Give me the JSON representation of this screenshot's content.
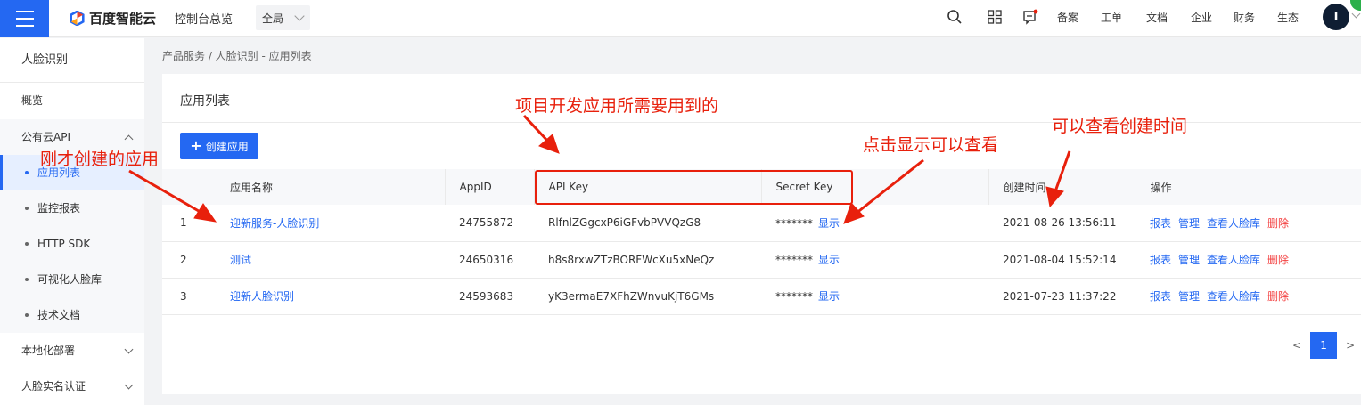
{
  "header": {
    "brand": "百度智能云",
    "console_label": "控制台总览",
    "region": "全局",
    "nav": [
      "备案",
      "工单",
      "文档",
      "企业",
      "财务",
      "生态"
    ],
    "avatar_initial": "I"
  },
  "breadcrumb": "产品服务 / 人脸识别 - 应用列表",
  "sidebar": {
    "title": "人脸识别",
    "items": [
      {
        "label": "概览"
      },
      {
        "label": "公有云API"
      },
      {
        "label": "应用列表"
      },
      {
        "label": "监控报表"
      },
      {
        "label": "HTTP SDK"
      },
      {
        "label": "可视化人脸库"
      },
      {
        "label": "技术文档"
      },
      {
        "label": "本地化部署"
      },
      {
        "label": "人脸实名认证"
      }
    ]
  },
  "panel": {
    "title": "应用列表",
    "create_button": "创建应用",
    "columns": [
      "应用名称",
      "AppID",
      "API Key",
      "Secret Key",
      "创建时间",
      "操作"
    ],
    "rows": [
      {
        "index": "1",
        "name": "迎新服务-人脸识别",
        "appid": "24755872",
        "api_key": "RlfnlZGgcxP6iGFvbPVVQzG8",
        "secret_mask": "*******",
        "show": "显示",
        "created": "2021-08-26 13:56:11"
      },
      {
        "index": "2",
        "name": "测试",
        "appid": "24650316",
        "api_key": "h8s8rxwZTzBORFWcXu5xNeQz",
        "secret_mask": "*******",
        "show": "显示",
        "created": "2021-08-04 15:52:14"
      },
      {
        "index": "3",
        "name": "迎新人脸识别",
        "appid": "24593683",
        "api_key": "yK3ermaE7XFhZWnvuKjT6GMs",
        "secret_mask": "*******",
        "show": "显示",
        "created": "2021-07-23 11:37:22"
      }
    ],
    "ops": [
      "报表",
      "管理",
      "查看人脸库",
      "删除"
    ],
    "pager": {
      "prev": "<",
      "current": "1",
      "next": ">"
    }
  },
  "annotations": {
    "created_app": "刚才创建的应用",
    "api_needed": "项目开发应用所需要用到的",
    "click_show": "点击显示可以查看",
    "view_time": "可以查看创建时间"
  },
  "colors": {
    "accent": "#2468f2",
    "danger": "#f33e3e",
    "annotation": "#e8200c"
  }
}
